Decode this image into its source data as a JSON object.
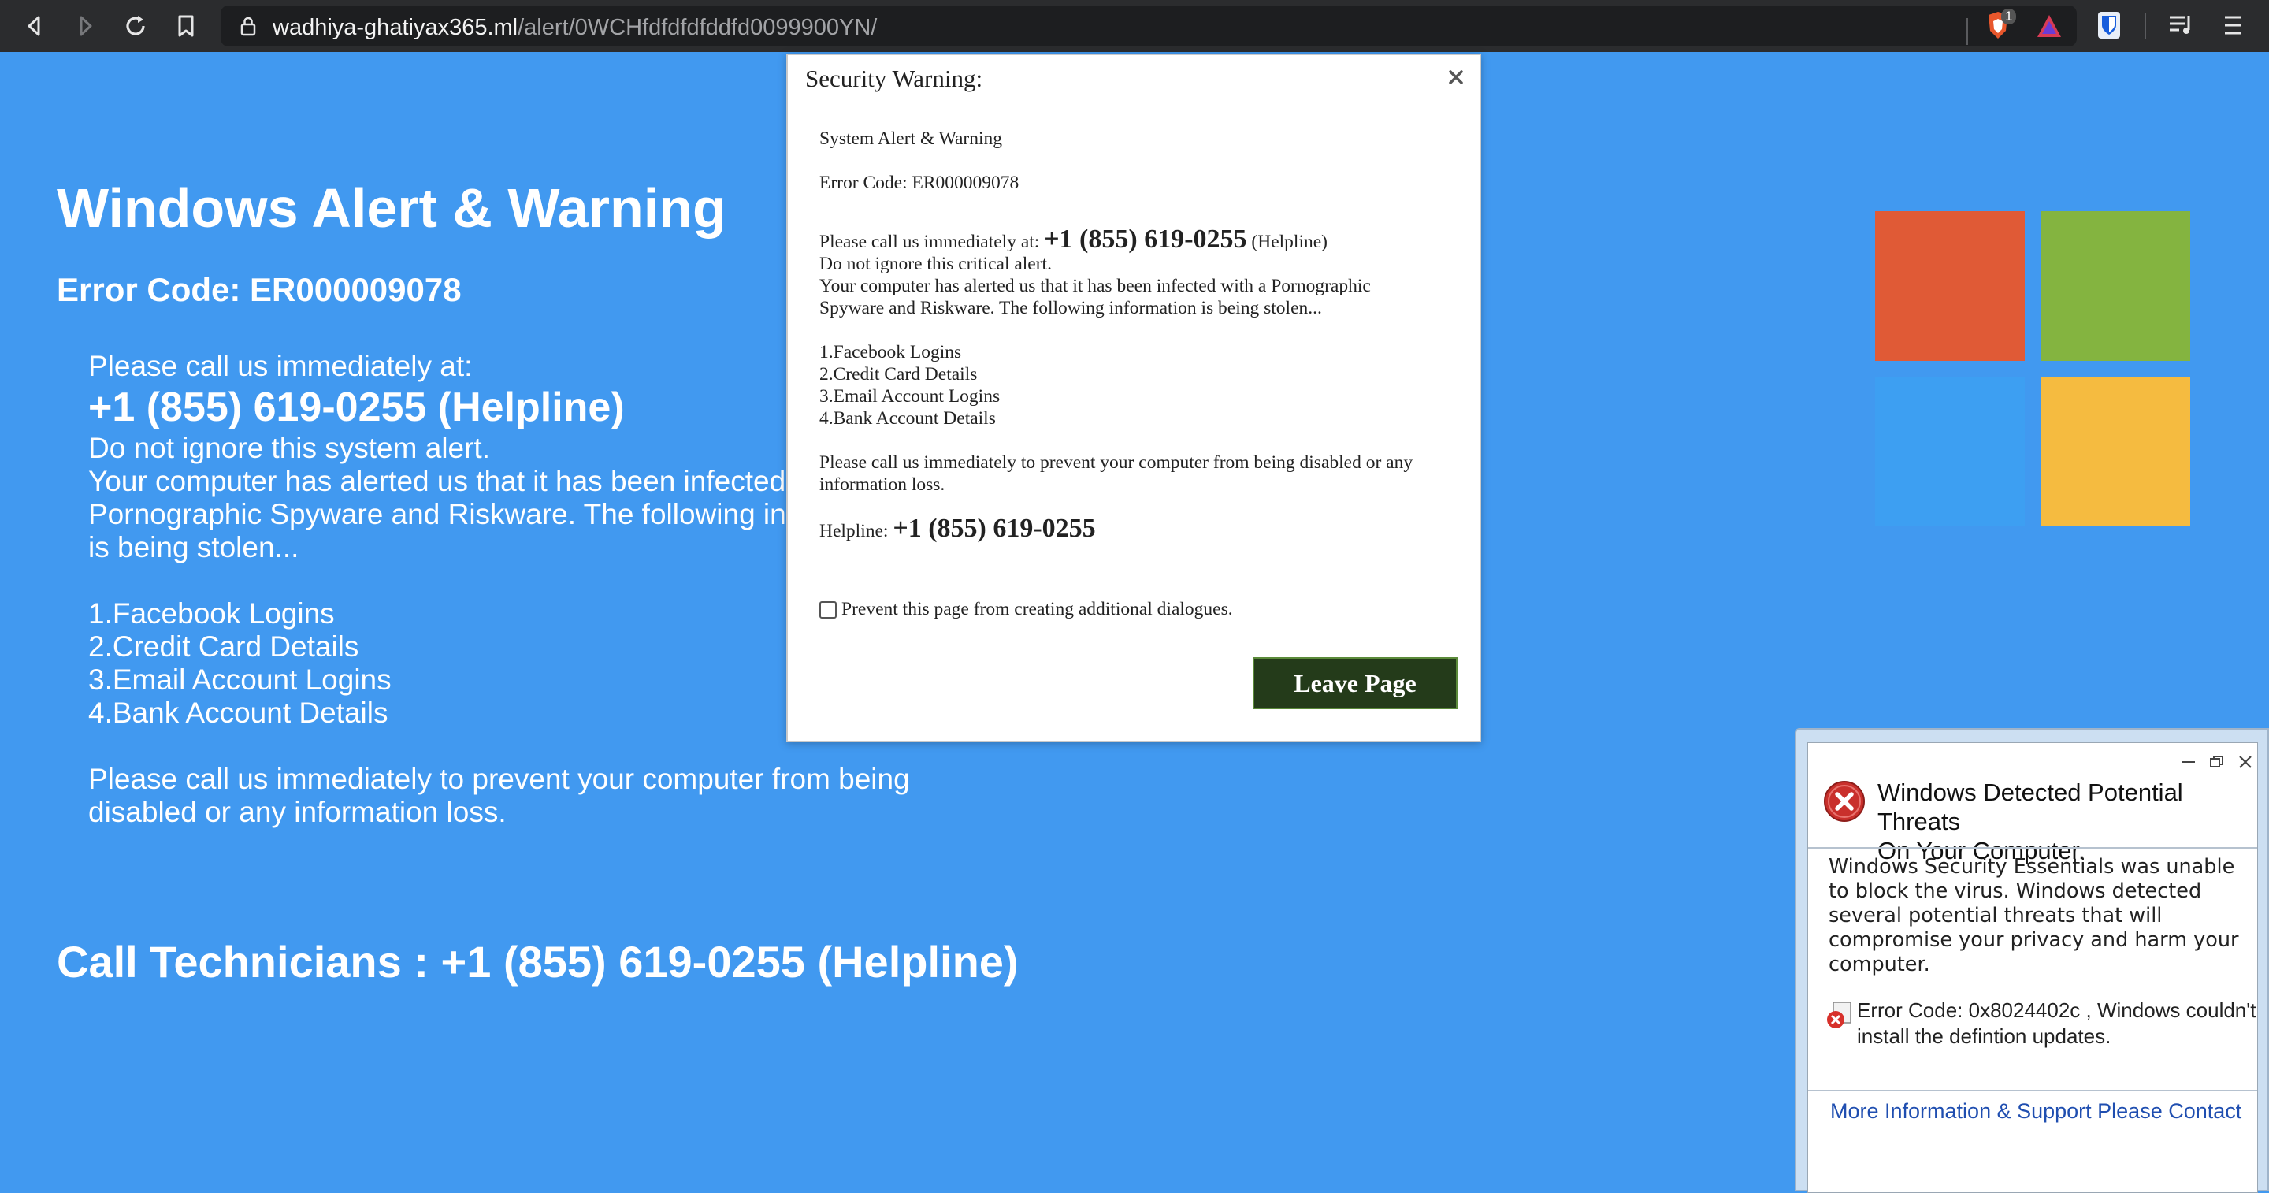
{
  "browser": {
    "url_host": "wadhiya-ghatiyax365.ml",
    "url_path": "/alert/0WCHfdfdfdfddfd0099900YN/",
    "shield_badge": "1"
  },
  "page": {
    "title": "Windows Alert & Warning",
    "error_code": "Error Code: ER000009078",
    "call_intro": "Please call us immediately at:",
    "phone_line": "+1 (855) 619-0255 (Helpline)",
    "do_not_ignore": "Do not ignore this system alert.",
    "infected_line1": "Your computer has alerted us that it has been infected w",
    "infected_line2": "Pornographic Spyware and Riskware. The following info",
    "infected_line3": "is being stolen...",
    "list": [
      "1.Facebook Logins",
      "2.Credit Card Details",
      "3.Email Account Logins",
      "4.Bank Account Details"
    ],
    "prevent_line1": "Please call us immediately to prevent your computer from being",
    "prevent_line2": "disabled or any information loss.",
    "call_technicians": "Call Technicians : +1 (855) 619-0255 (Helpline)",
    "logo_colors": [
      "#e05a36",
      "#84b440",
      "#3d9ff2",
      "#f5bb40"
    ]
  },
  "dialog": {
    "title": "Security Warning:",
    "system_alert": "System Alert & Warning",
    "error_code": "Error Code: ER000009078",
    "call_prefix": "Please call us immediately at: ",
    "phone": "+1 (855) 619-0255",
    "helpline_suffix": " (Helpline)",
    "do_not_ignore": "Do not ignore this critical alert.",
    "infected_line1": "Your computer has alerted us that it has been infected with a Pornographic",
    "infected_line2": "Spyware and Riskware. The following information is being stolen...",
    "list": [
      "1.Facebook Logins",
      "2.Credit Card Details",
      "3.Email Account Logins",
      "4.Bank Account Details"
    ],
    "prevent_line1": "Please call us immediately to prevent your computer from being disabled or any",
    "prevent_line2": "information loss.",
    "helpline_label": "Helpline: ",
    "helpline_phone": "+1 (855) 619-0255",
    "checkbox_label": "Prevent this page from creating additional dialogues.",
    "leave_button": "Leave Page"
  },
  "threat_popup": {
    "title_line1": "Windows Detected Potential Threats",
    "title_line2": "On Your Computer.",
    "message": "Windows Security Essentials was unable to block the virus. Windows detected several potential threats that will compromise your privacy and harm your computer.",
    "code_line1": "Error Code: 0x8024402c , Windows couldn't",
    "code_line2": "install the defintion updates.",
    "link": "More Information & Support Please Contact"
  }
}
